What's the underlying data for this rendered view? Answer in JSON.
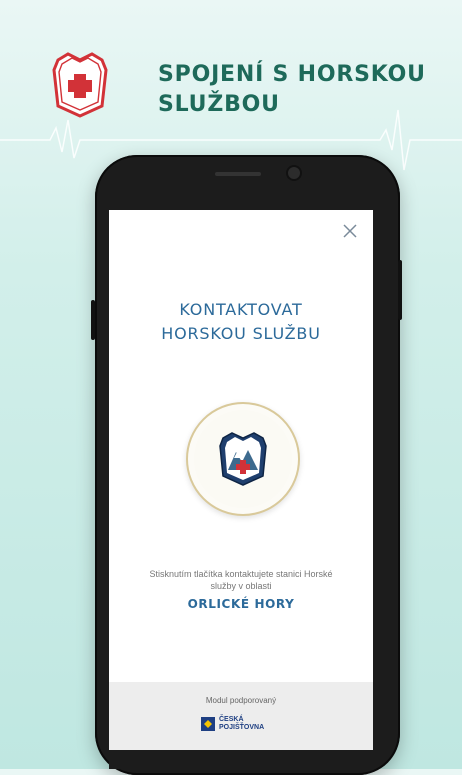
{
  "header": {
    "title": "SPOJENÍ S HORSKOU SLUŽBOU",
    "logo_icon": "mountain-rescue-logo"
  },
  "screen": {
    "close_icon": "close-icon",
    "title": "KONTAKTOVAT HORSKOU SLUŽBU",
    "call_button_icon": "mountain-rescue-logo",
    "hint": "Stisknutím tlačítka kontaktujete stanici Horské služby v oblasti",
    "region": "ORLICKÉ HORY",
    "footer": {
      "support_label": "Modul podporovaný",
      "sponsor_line1": "ČESKÁ",
      "sponsor_line2": "POJIŠŤOVNA"
    }
  },
  "colors": {
    "accent": "#2c6a9a",
    "header_text": "#1e6a5a",
    "background": "#c9ebe6",
    "logo_red": "#d23238"
  }
}
